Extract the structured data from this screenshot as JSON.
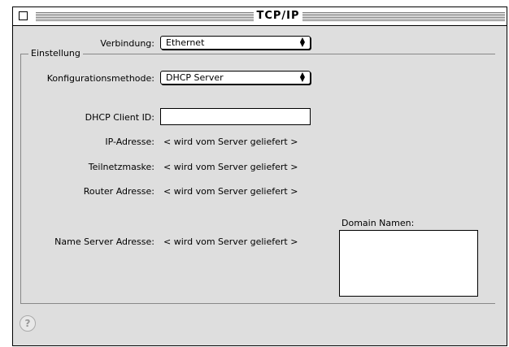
{
  "window": {
    "title": "TCP/IP"
  },
  "connection": {
    "label": "Verbindung:",
    "value": "Ethernet"
  },
  "settings": {
    "group_title": "Einstellung",
    "config_method": {
      "label": "Konfigurationsmethode:",
      "value": "DHCP Server"
    },
    "dhcp_client_id": {
      "label": "DHCP Client ID:",
      "value": ""
    },
    "ip_address": {
      "label": "IP-Adresse:",
      "value": "< wird vom Server geliefert >"
    },
    "subnet_mask": {
      "label": "Teilnetzmaske:",
      "value": "< wird vom Server geliefert >"
    },
    "router_address": {
      "label": "Router Adresse:",
      "value": "< wird vom Server geliefert >"
    },
    "name_server": {
      "label": "Name Server Adresse:",
      "value": "< wird vom Server geliefert >"
    },
    "domain_names": {
      "label": "Domain Namen:",
      "value": ""
    }
  },
  "icons": {
    "close": "close-box-icon",
    "help": "help-icon",
    "popup_arrows": "updown-arrows-icon"
  }
}
